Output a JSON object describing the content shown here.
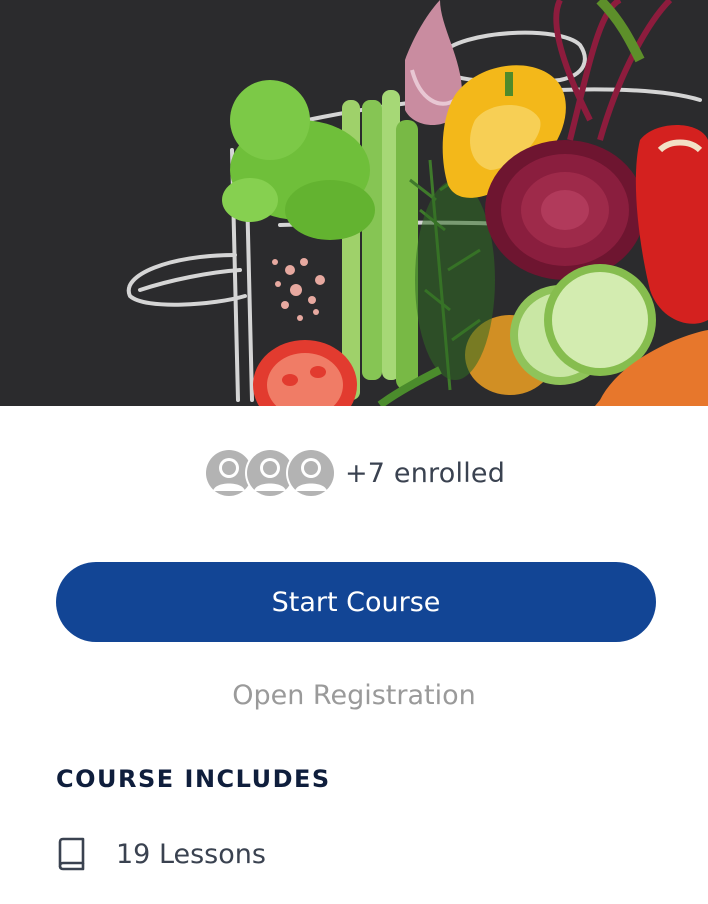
{
  "hero": {
    "image_desc_icon": "vegetables-pot-illustration"
  },
  "enrollment": {
    "count_label": "+7 enrolled",
    "avatar_icon": "user-avatar-icon"
  },
  "actions": {
    "start_label": "Start Course",
    "status_label": "Open Registration"
  },
  "includes": {
    "title": "COURSE INCLUDES",
    "items": [
      {
        "icon": "book-icon",
        "label": "19 Lessons"
      }
    ]
  },
  "colors": {
    "primary": "#124595",
    "heading": "#0f1e3c",
    "muted": "#9a9a9a",
    "text": "#3a4250",
    "avatar": "#b3b3b3"
  }
}
